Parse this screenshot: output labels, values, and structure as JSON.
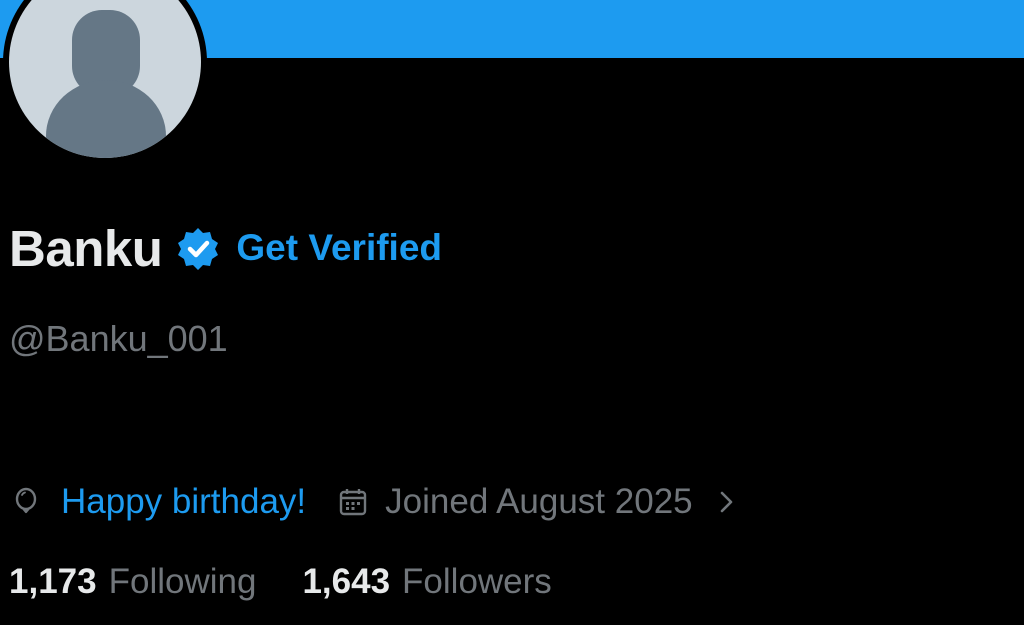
{
  "profile": {
    "display_name": "Banku",
    "get_verified_label": "Get Verified",
    "handle": "@Banku_001"
  },
  "meta": {
    "birthday_text": "Happy birthday!",
    "joined_text": "Joined August 2025"
  },
  "stats": {
    "following_count": "1,173",
    "following_label": "Following",
    "followers_count": "1,643",
    "followers_label": "Followers"
  },
  "icons": {
    "verified": "verified-badge-icon",
    "birthday": "balloon-icon",
    "joined": "calendar-icon",
    "more": "chevron-right-icon"
  },
  "colors": {
    "background": "#000000",
    "accent": "#1d9bf0",
    "primary_text": "#e7e9ea",
    "secondary_text": "#71767b",
    "avatar_bg": "#ccd6dd",
    "avatar_silhouette": "#657786"
  }
}
